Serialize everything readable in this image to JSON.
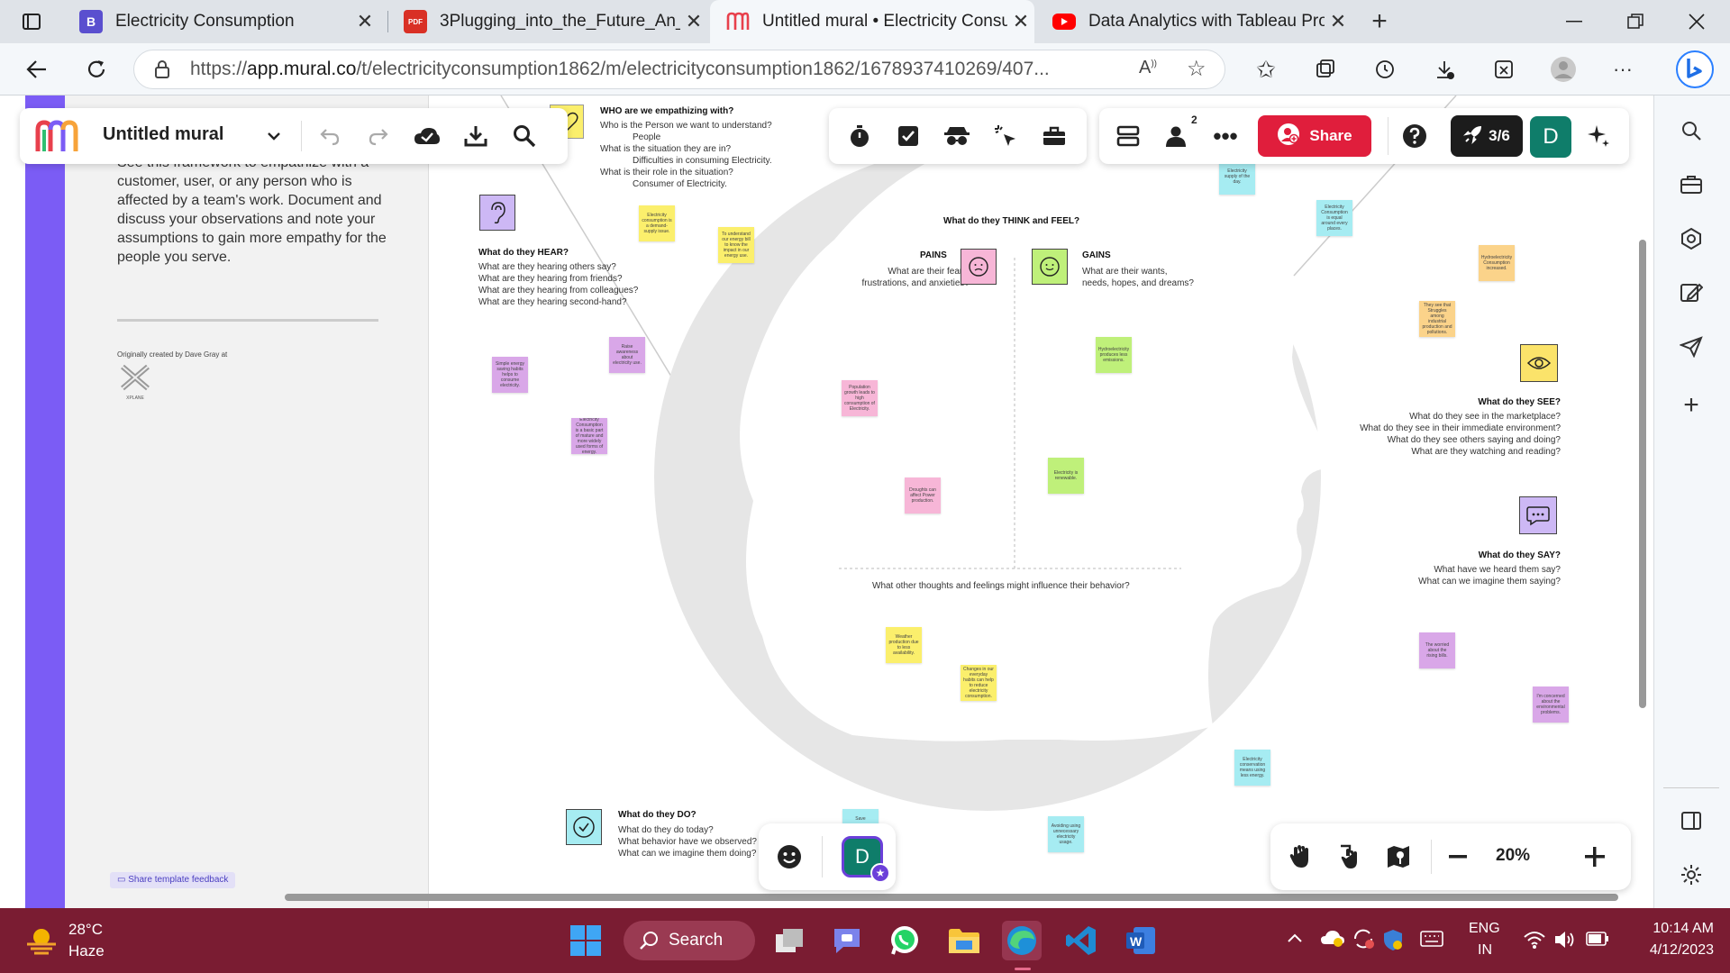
{
  "tabs": [
    {
      "label": "Electricity Consumption",
      "icon": "B",
      "color": "#5a4fcf"
    },
    {
      "label": "3Plugging_into_the_Future_An_E",
      "icon": "PDF",
      "color": "#d93025"
    },
    {
      "label": "Untitled mural • Electricity Consu",
      "icon": "M",
      "color": "#e8404c"
    },
    {
      "label": "Data Analytics with Tableau Proje",
      "icon": "yt",
      "color": "#ff0000"
    }
  ],
  "url": {
    "prefix": "https://",
    "host": "app.mural.co",
    "path": "/t/electricityconsumption1862/m/electricityconsumption1862/1678937410269/407..."
  },
  "mural": {
    "title": "Untitled mural",
    "share_label": "Share",
    "pager": "3/6",
    "avatar_letter": "D",
    "participant_count": "2",
    "zoom": "20%"
  },
  "left_panel": {
    "description": "See this framework to empathize with a customer, user, or any person who is affected by a team's work. Document and discuss your observations and note your assumptions to gain more empathy for the people you serve.",
    "credit": "Originally created by Dave Gray at",
    "logo_text": "XPLANE",
    "feedback": "Share template feedback"
  },
  "empathy": {
    "who_title": "WHO are we empathizing with?",
    "who_q1": "Who is the Person we want to understand?",
    "who_a1": "People",
    "who_q2": "What is the situation they are in?",
    "who_a2": "Difficulties in consuming Electricity.",
    "who_q3": "What is their role in the situation?",
    "who_a3": "Consumer of Electricity.",
    "hear_title": "What do they HEAR?",
    "hear_q": [
      "What are they hearing others say?",
      "What are they hearing from friends?",
      "What are they hearing from colleagues?",
      "What are they hearing second-hand?"
    ],
    "think_title": "What do they THINK and FEEL?",
    "pains_title": "PAINS",
    "pains_q": [
      "What are their fears,",
      "frustrations, and anxieties?"
    ],
    "gains_title": "GAINS",
    "gains_q": [
      "What are their wants,",
      "needs, hopes, and dreams?"
    ],
    "other_q": "What other thoughts and feelings might influence their behavior?",
    "see_title": "What do they SEE?",
    "see_q": [
      "What do they see in the marketplace?",
      "What do they see in their immediate environment?",
      "What do they see others saying and doing?",
      "What are they watching and reading?"
    ],
    "say_title": "What do they SAY?",
    "say_q": [
      "What have we heard them say?",
      "What can we imagine them saying?"
    ],
    "do_title": "What do they DO?",
    "do_q": [
      "What do they do today?",
      "What behavior have we observed?",
      "What can we imagine them doing?"
    ],
    "need_title": "nee"
  },
  "stickies": {
    "s1": "Electricity consumption is a demand-supply issue.",
    "s2": "To understand our energy bill to know the impact in our energy use.",
    "s3": "Simple energy saving habits helps to consume electricity.",
    "s4": "Electricity Consumption is a basic part of mature and more widely used forms of energy.",
    "s5": "Raise awareness about electricity use.",
    "s6": "Population growth leads to high consumption of Electricity.",
    "s7": "Droughts can affect Power production.",
    "s8": "Hydroelectricity produces less emissions.",
    "s9": "Electricity is renewable.",
    "s10": "Electricity Consumption is equal around every places.",
    "s11": "Hydroelectricity Consumption increased.",
    "s12": "They see that Struggles among industrial production and pollutions.",
    "s13": "Weather production due to less availability.",
    "s14": "Changes in our everyday habits can help to reduce electricity consumption.",
    "s15": "The worried about the rising bills.",
    "s16": "I'm concerned about the environmental problems.",
    "s17": "Electricity conservation means using less energy.",
    "s18": "Save",
    "s19": "Avoiding using unnecessary electricity usage.",
    "s20": "Electricity supply of the day."
  },
  "taskbar": {
    "temp": "28°C",
    "weather": "Haze",
    "search": "Search",
    "lang1": "ENG",
    "lang2": "IN",
    "time": "10:14 AM",
    "date": "4/12/2023"
  },
  "colors": {
    "mural_red": "#e8404c",
    "mural_purple": "#7b5cf5",
    "teal": "#0f7d6a",
    "taskbar": "#7a1c32"
  }
}
